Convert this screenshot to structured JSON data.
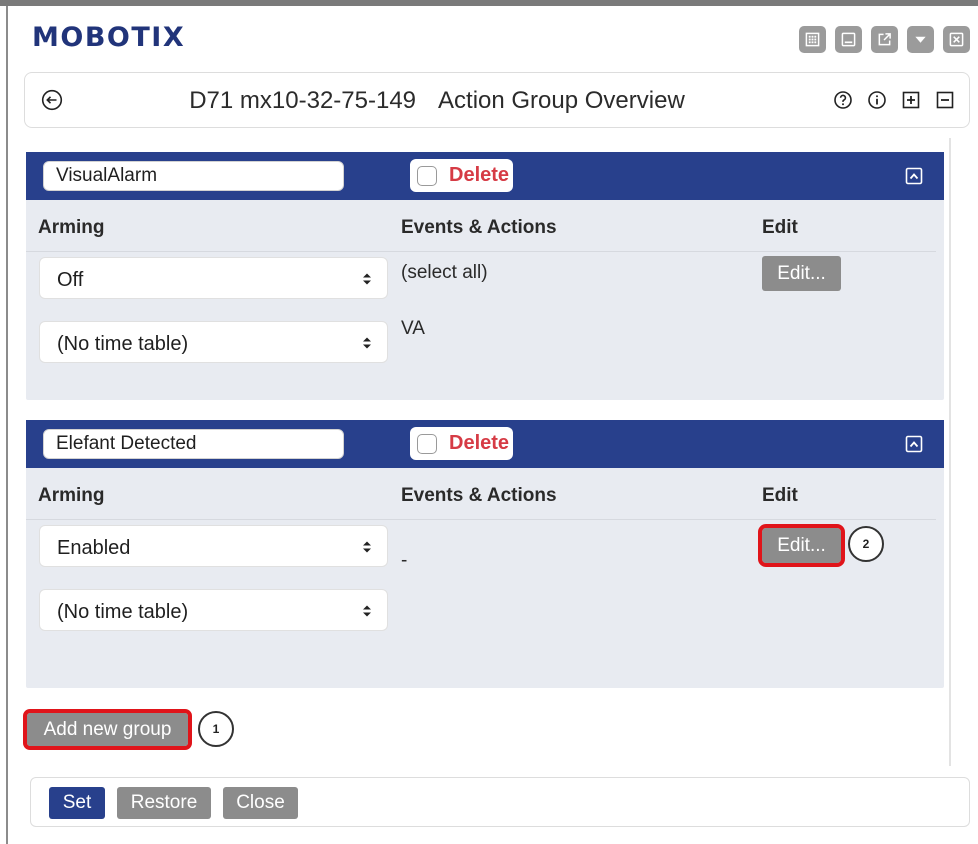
{
  "app": {
    "logo": "MOBOTIX"
  },
  "window_icons": [
    "grid-icon",
    "minimize-icon",
    "popout-icon",
    "dropdown-icon",
    "close-icon"
  ],
  "titlebar": {
    "camera_name": "D71 mx10-32-75-149",
    "page_title": "Action Group Overview",
    "tools": [
      "help-icon",
      "info-icon",
      "expand-all-icon",
      "collapse-all-icon"
    ]
  },
  "columns": {
    "arming": "Arming",
    "events": "Events & Actions",
    "edit": "Edit"
  },
  "groups": [
    {
      "name": "VisualAlarm",
      "delete_label": "Delete",
      "arming_value": "Off",
      "timetable_value": "(No time table)",
      "events_select_all": "(select all)",
      "events_item": "VA",
      "edit_label": "Edit..."
    },
    {
      "name": "Elefant Detected",
      "delete_label": "Delete",
      "arming_value": "Enabled",
      "timetable_value": "(No time table)",
      "events_item": "-",
      "edit_label": "Edit...",
      "callout": "2"
    }
  ],
  "add_group": {
    "label": "Add new group",
    "callout": "1"
  },
  "footer": {
    "set": "Set",
    "restore": "Restore",
    "close": "Close"
  },
  "colors": {
    "brand": "#21347a",
    "header_bar": "#28408c",
    "delete_text": "#d63b45",
    "highlight": "#e0141a",
    "button_gray": "#8c8c8c",
    "panel_bg": "#e8ebf1"
  }
}
